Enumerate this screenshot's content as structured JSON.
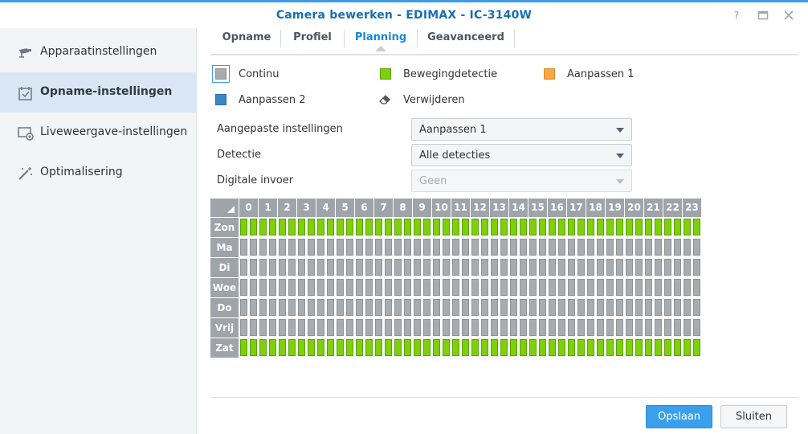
{
  "window": {
    "title": "Camera bewerken - EDIMAX - IC-3140W"
  },
  "sidebar": {
    "items": [
      {
        "label": "Apparaatinstellingen",
        "icon": "camera-icon"
      },
      {
        "label": "Opname-instellingen",
        "icon": "calendar-icon",
        "active": true
      },
      {
        "label": "Liveweergave-instellingen",
        "icon": "monitor-icon"
      },
      {
        "label": "Optimalisering",
        "icon": "magic-wand-icon"
      }
    ]
  },
  "tabs": [
    {
      "label": "Opname"
    },
    {
      "label": "Profiel"
    },
    {
      "label": "Planning",
      "active": true
    },
    {
      "label": "Geavanceerd"
    }
  ],
  "legend": [
    {
      "label": "Continu",
      "color": "#a7acb1"
    },
    {
      "label": "Bewegingdetectie",
      "color": "#7cd10a"
    },
    {
      "label": "Aanpassen 1",
      "color": "#f7a845"
    },
    {
      "label": "Aanpassen 2",
      "color": "#3d86c6"
    },
    {
      "label": "Verwijderen",
      "icon": "eraser-icon"
    }
  ],
  "form": {
    "custom_settings_label": "Aangepaste instellingen",
    "custom_settings_value": "Aanpassen 1",
    "detection_label": "Detectie",
    "detection_value": "Alle detecties",
    "digital_input_label": "Digitale invoer",
    "digital_input_value": "Geen"
  },
  "schedule": {
    "hours": [
      "0",
      "1",
      "2",
      "3",
      "4",
      "5",
      "6",
      "7",
      "8",
      "9",
      "10",
      "11",
      "12",
      "13",
      "14",
      "15",
      "16",
      "17",
      "18",
      "19",
      "20",
      "21",
      "22",
      "23"
    ],
    "days": [
      {
        "label": "Zon",
        "mode": "motion"
      },
      {
        "label": "Ma",
        "mode": "off"
      },
      {
        "label": "Di",
        "mode": "off"
      },
      {
        "label": "Woe",
        "mode": "off"
      },
      {
        "label": "Do",
        "mode": "off"
      },
      {
        "label": "Vrij",
        "mode": "off"
      },
      {
        "label": "Zat",
        "mode": "motion"
      }
    ]
  },
  "footer": {
    "save_label": "Opslaan",
    "close_label": "Sluiten"
  }
}
